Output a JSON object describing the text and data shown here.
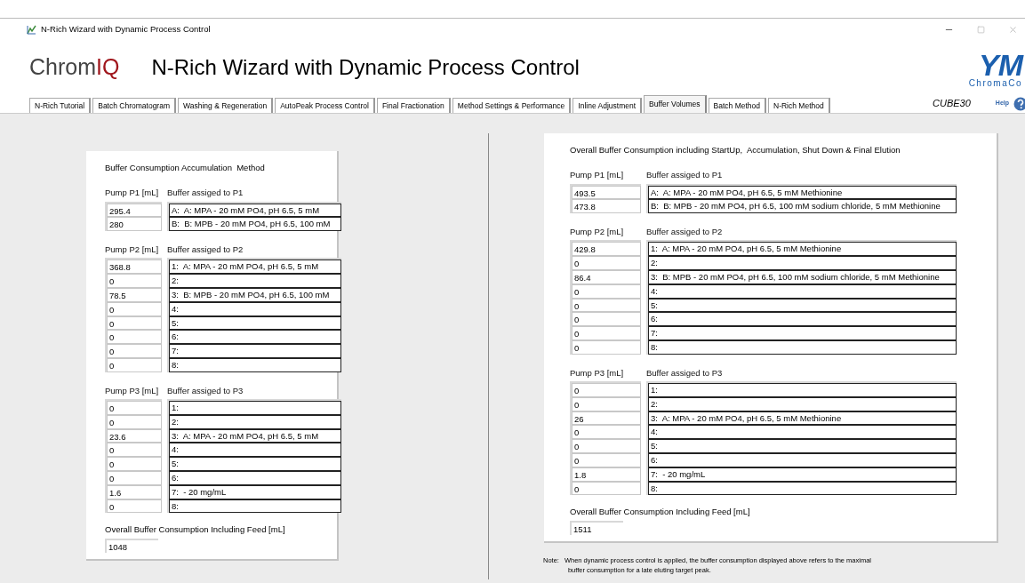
{
  "window": {
    "title": "N-Rich Wizard with Dynamic Process Control"
  },
  "header": {
    "brand_prefix": "Chrom",
    "brand_suffix": "IQ",
    "title": "N-Rich Wizard with Dynamic Process Control",
    "logo": "YM",
    "logo_sub": "ChromaCo",
    "device": "CUBE30",
    "help": "Help"
  },
  "tabs": [
    {
      "label": "N-Rich Tutorial",
      "selected": false
    },
    {
      "label": "Batch Chromatogram",
      "selected": false
    },
    {
      "label": "Washing & Regeneration",
      "selected": false
    },
    {
      "label": "AutoPeak Process Control",
      "selected": false
    },
    {
      "label": "Final Fractionation",
      "selected": false
    },
    {
      "label": "Method Settings & Performance",
      "selected": false
    },
    {
      "label": "Inline Adjustment",
      "selected": false
    },
    {
      "label": "Buffer Volumes",
      "selected": true
    },
    {
      "label": "Batch Method",
      "selected": false
    },
    {
      "label": "N-Rich Method",
      "selected": false
    }
  ],
  "panels": [
    {
      "title": "Buffer Consumption Accumulation  Method",
      "groups": [
        {
          "pump_label": "Pump P1 [mL]",
          "buffer_label": "Buffer assiged to P1",
          "values": [
            "295.4",
            "280"
          ],
          "buffers": [
            "A:  A: MPA - 20 mM PO4, pH 6.5, 5 mM",
            "B:  B: MPB - 20 mM PO4, pH 6.5, 100 mM"
          ]
        },
        {
          "pump_label": "Pump P2 [mL]",
          "buffer_label": "Buffer assiged to P2",
          "values": [
            "368.8",
            "0",
            "78.5",
            "0",
            "0",
            "0",
            "0",
            "0"
          ],
          "buffers": [
            "1:  A: MPA - 20 mM PO4, pH 6.5, 5 mM",
            "2:",
            "3:  B: MPB - 20 mM PO4, pH 6.5, 100 mM",
            "4:",
            "5:",
            "6:",
            "7:",
            "8:"
          ]
        },
        {
          "pump_label": "Pump P3 [mL]",
          "buffer_label": "Buffer assiged to P3",
          "values": [
            "0",
            "0",
            "23.6",
            "0",
            "0",
            "0",
            "1.6",
            "0"
          ],
          "buffers": [
            "1:",
            "2:",
            "3:  A: MPA - 20 mM PO4, pH 6.5, 5 mM",
            "4:",
            "5:",
            "6:",
            "7:  - 20 mg/mL",
            "8:"
          ]
        }
      ],
      "overall_label": "Overall Buffer Consumption Including Feed [mL]",
      "overall_value": "1048"
    },
    {
      "title": "Overall Buffer Consumption including StartUp,  Accumulation, Shut Down & Final Elution",
      "groups": [
        {
          "pump_label": "Pump P1 [mL]",
          "buffer_label": "Buffer assiged to P1",
          "values": [
            "493.5",
            "473.8"
          ],
          "buffers": [
            "A:  A: MPA - 20 mM PO4, pH 6.5, 5 mM Methionine",
            "B:  B: MPB - 20 mM PO4, pH 6.5, 100 mM sodium chloride, 5 mM Methionine"
          ]
        },
        {
          "pump_label": "Pump P2 [mL]",
          "buffer_label": "Buffer assiged to P2",
          "values": [
            "429.8",
            "0",
            "86.4",
            "0",
            "0",
            "0",
            "0",
            "0"
          ],
          "buffers": [
            "1:  A: MPA - 20 mM PO4, pH 6.5, 5 mM Methionine",
            "2:",
            "3:  B: MPB - 20 mM PO4, pH 6.5, 100 mM sodium chloride, 5 mM Methionine",
            "4:",
            "5:",
            "6:",
            "7:",
            "8:"
          ]
        },
        {
          "pump_label": "Pump P3 [mL]",
          "buffer_label": "Buffer assiged to P3",
          "values": [
            "0",
            "0",
            "26",
            "0",
            "0",
            "0",
            "1.8",
            "0"
          ],
          "buffers": [
            "1:",
            "2:",
            "3:  A: MPA - 20 mM PO4, pH 6.5, 5 mM Methionine",
            "4:",
            "5:",
            "6:",
            "7:  - 20 mg/mL",
            "8:"
          ]
        }
      ],
      "overall_label": "Overall Buffer Consumption Including Feed [mL]",
      "overall_value": "1511"
    }
  ],
  "note": {
    "label": "Note:",
    "lines": [
      "When dynamic process control is applied, the buffer consumption displayed above refers to the maximal",
      "buffer consumption for a late eluting target peak."
    ]
  }
}
